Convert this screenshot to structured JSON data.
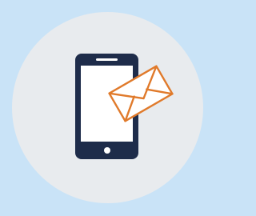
{
  "colors": {
    "background": "#c9e3f7",
    "circle": "#e8ebee",
    "phone": "#1e2c4a",
    "envelope_stroke": "#e07a2b",
    "envelope_fill": "#ffffff"
  },
  "icons": {
    "phone": "smartphone-icon",
    "envelope": "envelope-icon"
  }
}
